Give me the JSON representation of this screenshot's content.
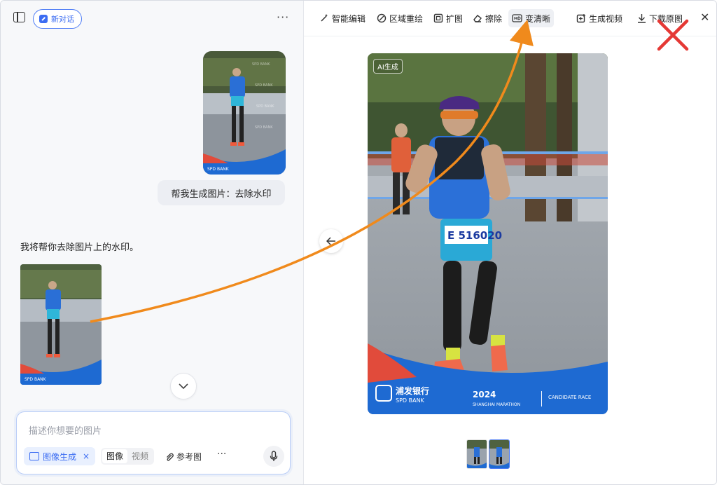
{
  "left": {
    "new_chat_label": "新对话",
    "user_message": "帮我生成图片：去除水印",
    "assistant_message": "我将帮你去除图片上的水印。",
    "composer": {
      "placeholder": "描述你想要的图片",
      "mode_chip": "图像生成",
      "mode_chip_close": "×",
      "seg_image": "图像",
      "seg_video": "视频",
      "reference": "参考图",
      "more": "···"
    }
  },
  "toolbar": {
    "items": [
      {
        "label": "智能编辑",
        "icon": "magic-wand-icon"
      },
      {
        "label": "区域重绘",
        "icon": "region-brush-icon"
      },
      {
        "label": "扩图",
        "icon": "expand-icon"
      },
      {
        "label": "擦除",
        "icon": "eraser-icon"
      },
      {
        "label": "变清晰",
        "icon": "hd-icon"
      },
      {
        "label": "生成视频",
        "icon": "video-plus-icon"
      },
      {
        "label": "下载原图",
        "icon": "download-icon"
      }
    ],
    "active_index": 4
  },
  "preview": {
    "ai_badge": "AI生成",
    "bib_number": "E 516020",
    "bank_name": "浦发银行",
    "bank_name_en": "SPD BANK",
    "event_year": "2024",
    "event_en": "SHANGHAI MARATHON",
    "race_tag": "CANDIDATE RACE"
  },
  "colors": {
    "accent": "#3b6cf2",
    "annotation_arrow": "#f08a1c",
    "annotation_x": "#e53935"
  }
}
